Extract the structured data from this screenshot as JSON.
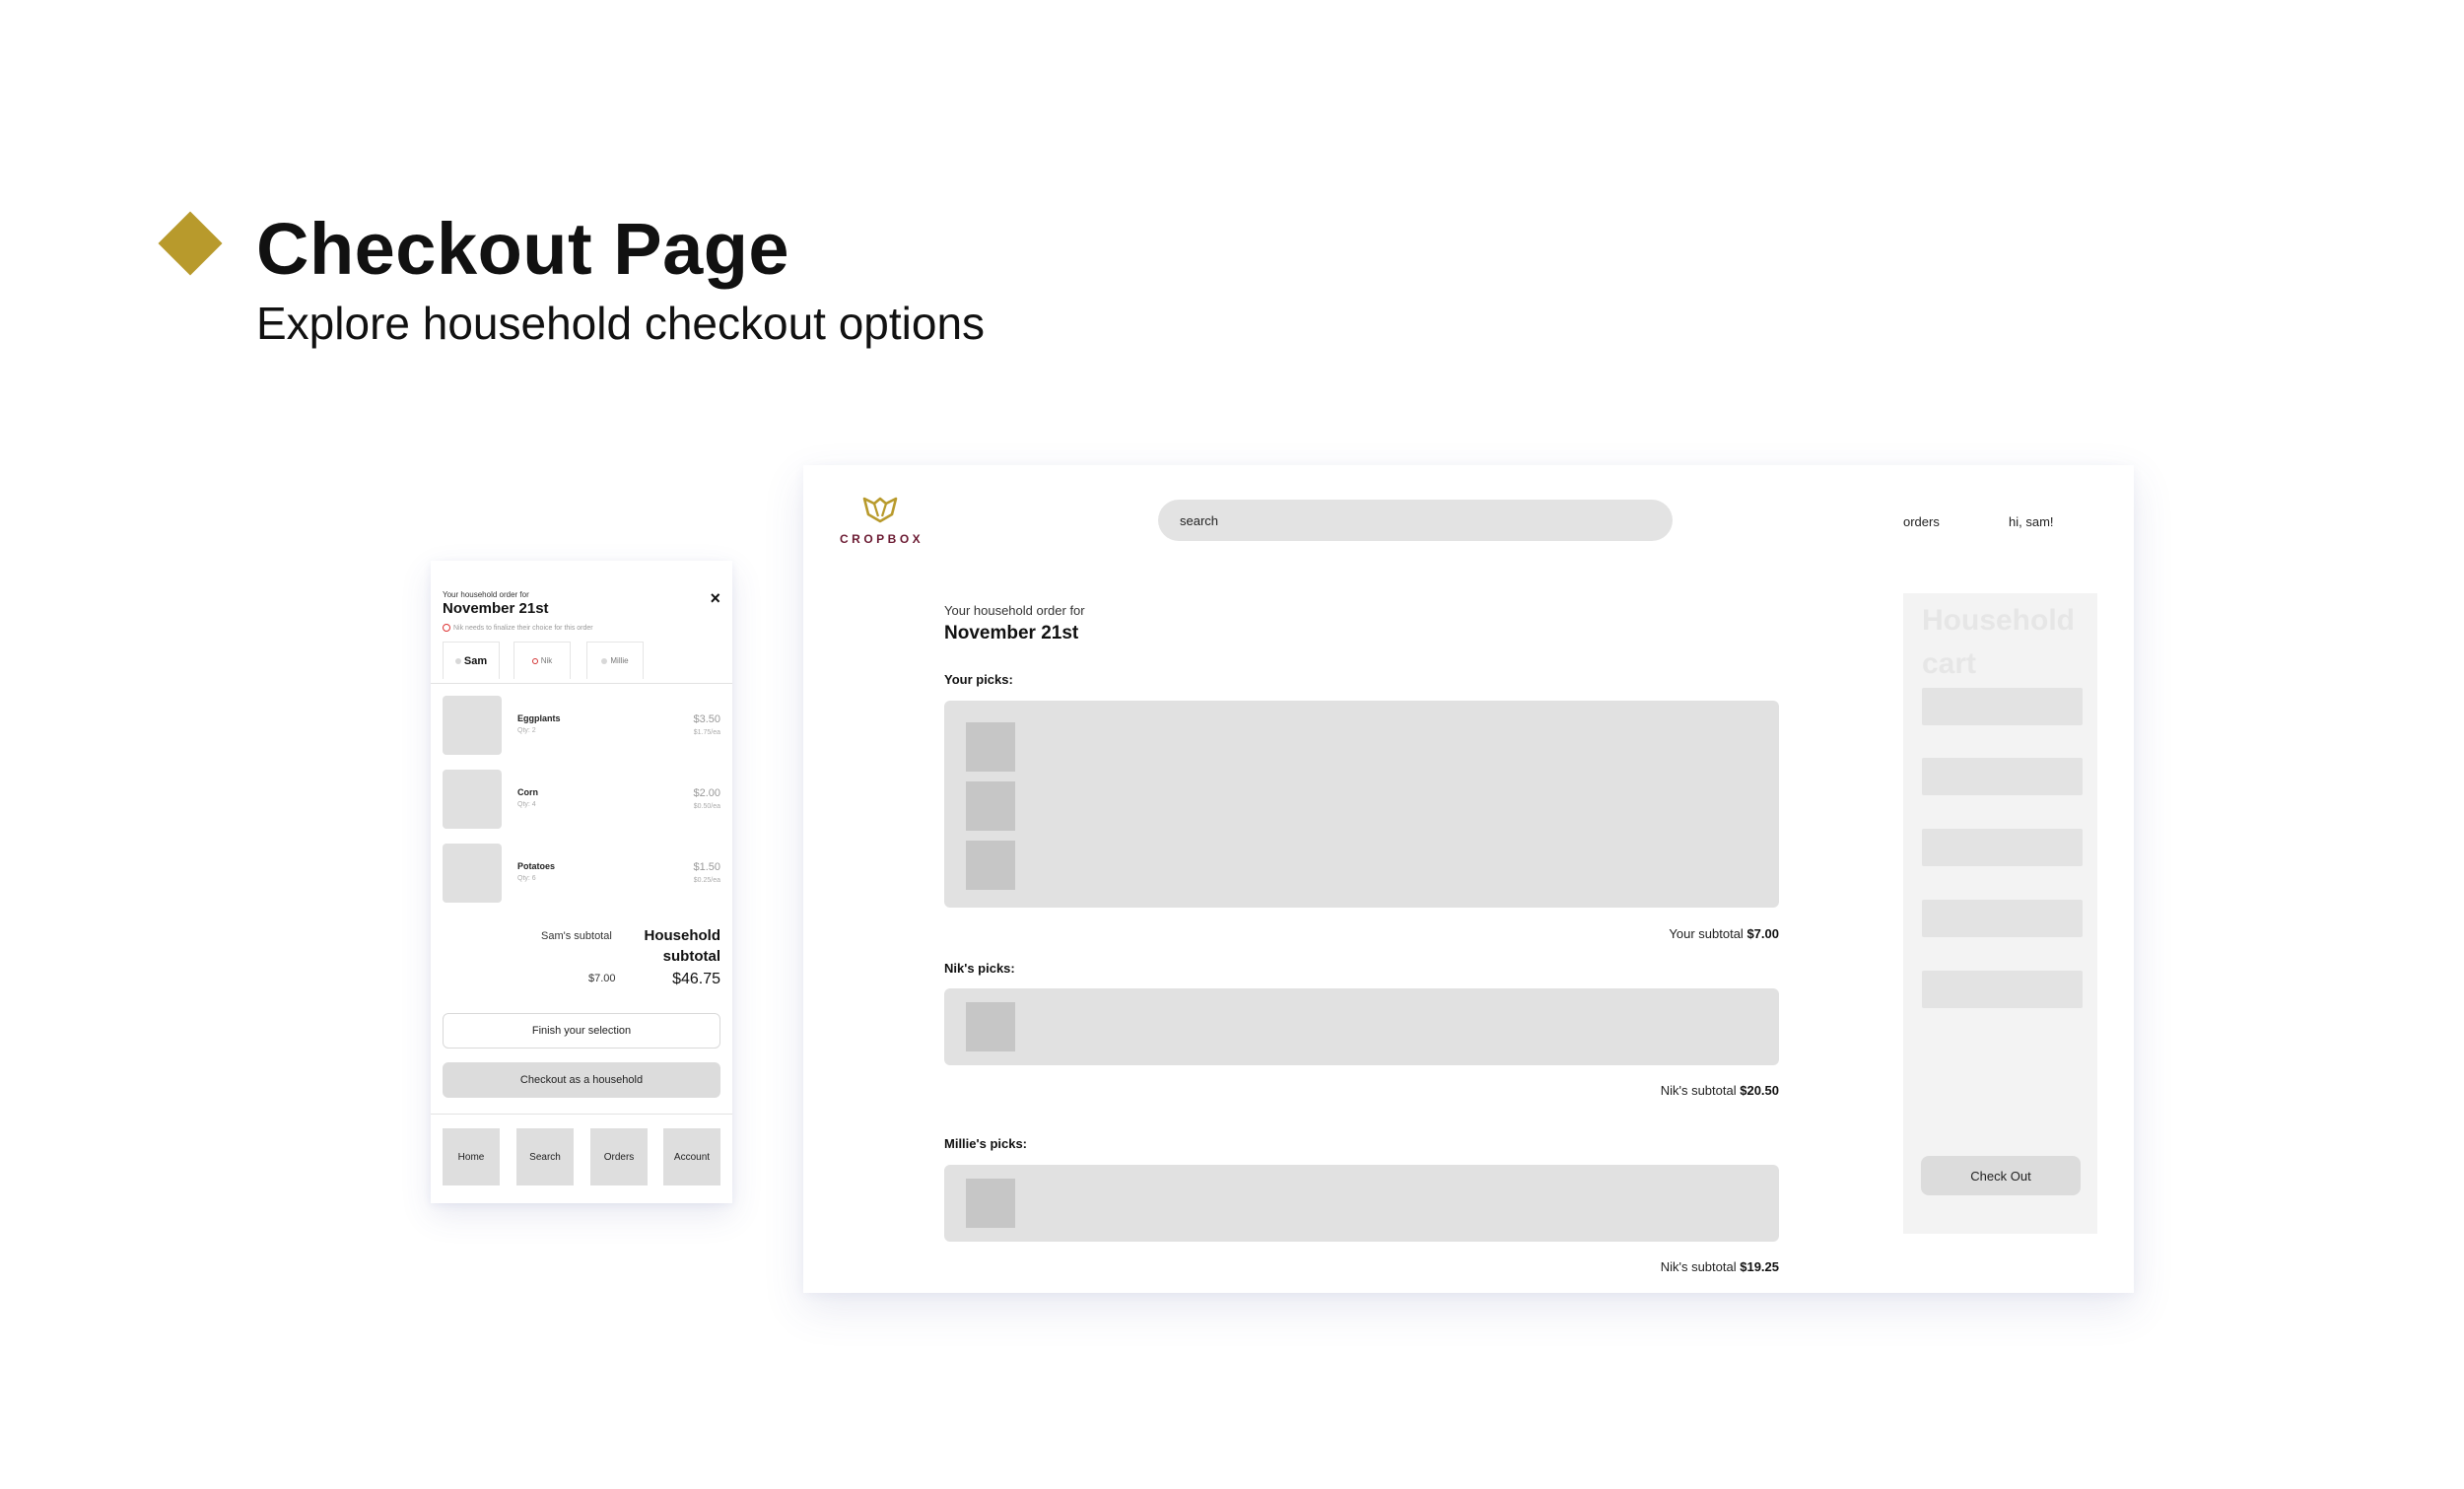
{
  "header": {
    "title": "Checkout Page",
    "subtitle": "Explore household checkout options",
    "accent_color": "#b89a2c"
  },
  "mobile": {
    "order_prefix": "Your household order for",
    "order_date": "November 21st",
    "close_icon": "×",
    "warning": "Nik needs to finalize their choice for this order",
    "tabs": [
      {
        "label": "Sam",
        "dot_color": "#d8d8d8"
      },
      {
        "label": "Nik",
        "dot_color": "#d33333"
      },
      {
        "label": "Millie",
        "dot_color": "#d8d8d8"
      }
    ],
    "items": [
      {
        "name": "Eggplants",
        "qty": "Qty: 2",
        "price": "$3.50",
        "each": "$1.75/ea"
      },
      {
        "name": "Corn",
        "qty": "Qty: 4",
        "price": "$2.00",
        "each": "$0.50/ea"
      },
      {
        "name": "Potatoes",
        "qty": "Qty: 6",
        "price": "$1.50",
        "each": "$0.25/ea"
      }
    ],
    "subtotal_label": "Sam's subtotal",
    "subtotal_value": "$7.00",
    "household_label": "Household subtotal",
    "household_value": "$46.75",
    "finish_button": "Finish your selection",
    "checkout_button": "Checkout as a household",
    "nav": [
      "Home",
      "Search",
      "Orders",
      "Account"
    ]
  },
  "desktop": {
    "brand": "CROPBOX",
    "brand_color": "#6b1a32",
    "logo_color": "#b89a2c",
    "search_placeholder": "search",
    "nav_orders": "orders",
    "nav_greeting": "hi, sam!",
    "order_prefix": "Your household order for",
    "order_date": "November 21st",
    "sections": [
      {
        "label": "Your picks:",
        "subtotal_label": "Your subtotal",
        "subtotal_value": "$7.00"
      },
      {
        "label": "Nik's picks:",
        "subtotal_label": "Nik's subtotal",
        "subtotal_value": "$20.50"
      },
      {
        "label": "Millie's picks:",
        "subtotal_label": "Nik's subtotal",
        "subtotal_value": "$19.25"
      }
    ],
    "cart_title": "Household cart",
    "checkout_button": "Check Out"
  }
}
